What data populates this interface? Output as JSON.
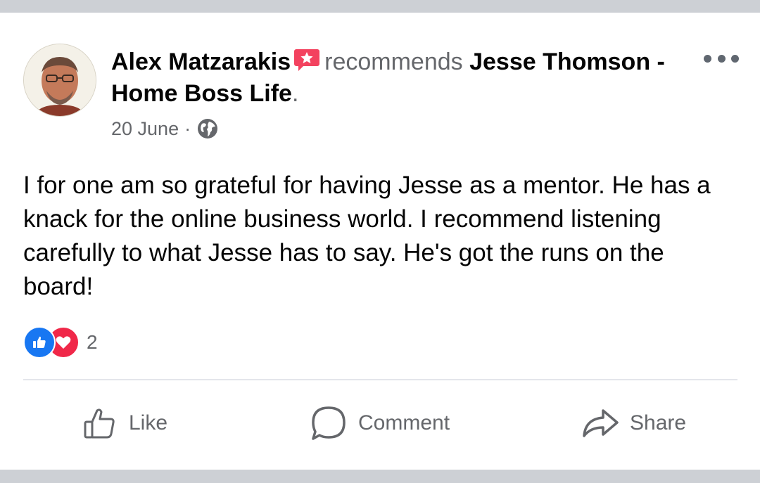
{
  "post": {
    "author": "Alex Matzarakis",
    "action": "recommends",
    "page_name": "Jesse Thomson - Home Boss Life",
    "trailing_punct": ".",
    "date": "20 June",
    "separator": "·",
    "audience_icon": "globe-icon",
    "badge_icon": "recommendation-star-icon",
    "more_icon": "more-options-icon",
    "body": "I for one am so grateful for having Jesse as a mentor. He has a knack for the online business world. I recommend listening carefully to what Jesse has to say. He's got the runs on the board!"
  },
  "reactions": {
    "types": [
      "like-reaction-icon",
      "love-reaction-icon"
    ],
    "count": "2"
  },
  "actions": {
    "like_label": "Like",
    "comment_label": "Comment",
    "share_label": "Share"
  },
  "colors": {
    "text": "#050505",
    "secondary_text": "#65676b",
    "like_blue": "#1877f2",
    "love_red": "#f02849",
    "badge_pink": "#f3425f",
    "page_background": "#cdd0d5",
    "card_background": "#ffffff"
  }
}
